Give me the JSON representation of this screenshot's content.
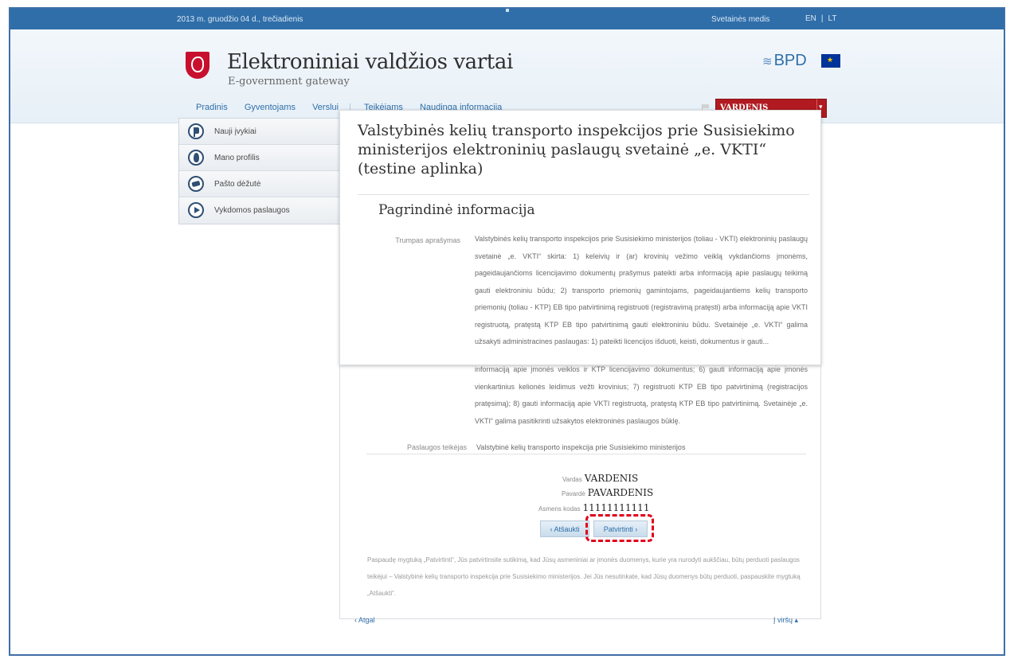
{
  "topbar": {
    "date": "2013 m. gruodžio 04 d., trečiadienis",
    "sitemap": "Svetainės medis",
    "lang_en": "EN",
    "lang_sep": "|",
    "lang_lt": "LT"
  },
  "header": {
    "title": "Elektroniniai valdžios vartai",
    "subtitle": "E-government gateway",
    "bpd": "BPD"
  },
  "nav": {
    "items": [
      "Pradinis",
      "Gyventojams",
      "Verslui",
      "Teikėjams",
      "Naudinga informacija"
    ],
    "user_name": "VARDENIS PAVARDENIS"
  },
  "sidebar": {
    "items": [
      "Nauji įvykiai",
      "Mano profilis",
      "Pašto dėžutė",
      "Vykdomos paslaugos"
    ]
  },
  "main": {
    "page_title": "Valstybinės kelių transporto inspekcijos prie Susisiekimo ministerijos elektroninių paslaugų svetainė „e. VKTI“ (testine aplinka)",
    "section_title": "Pagrindinė informacija",
    "short_desc_label": "Trumpas aprašymas",
    "short_desc_top": "Valstybinės kelių transporto inspekcijos prie Susisiekimo ministerijos (toliau - VKTI) elektroninių paslaugų svetainė „e. VKTI“ skirta: 1) keleivių ir (ar) krovinių vežimo veiklą vykdančioms įmonėms, pageidaujančioms licencijavimo dokumentų prašymus pateikti arba informaciją apie paslaugų teikimą gauti elektroniniu būdu; 2) transporto priemonių gamintojams, pageidaujantiems kelių transporto priemonių (toliau - KTP) EB tipo patvirtinimą registruoti (registravimą pratęsti) arba informaciją apie VKTI registruotą, pratęstą KTP EB tipo patvirtinimą gauti elektroniniu būdu. Svetainėje „e. VKTI“ galima užsakyti administracines paslaugas: 1) pateikti licencijos išduoti, keisti, dokumentus ir gauti...",
    "short_desc_bottom": "informaciją apie įmonės veiklos ir KTP licencijavimo dokumentus; 6) gauti informaciją apie įmonės vienkartinius kelionės leidimus vežti krovinius; 7) registruoti KTP EB tipo patvirtinimą (registracijos pratęsimą); 8) gauti informaciją apie VKTI registruotą, pratęstą KTP EB tipo patvirtinimą. Svetainėje „e. VKTI“ galima pasitikrinti užsakytos elektroninės paslaugos būklę.",
    "provider_label": "Paslaugos teikėjas",
    "provider_value": "Valstybinė kelių transporto inspekcija prie Susisiekimo ministerijos",
    "vardas_label": "Vardas",
    "vardas_value": "VARDENIS",
    "pavarde_label": "Pavardė",
    "pavarde_value": "PAVARDENIS",
    "asmens_label": "Asmens kodas",
    "asmens_value": "11111111111",
    "cancel_button": "‹  Atšaukti",
    "confirm_button": "Patvirtinti  ›",
    "notice": "Paspaudę mygtuką „Patvirtinti“, Jūs patvirtinsite sutikimą, kad Jūsų asmeniniai ar įmonės duomenys, kurie yra nurodyti aukščiau, būtų perduoti paslaugos teikėjui – Valstybinė kelių transporto inspekcija prie Susisiekimo ministerijos. Jei Jūs nesutinkate, kad Jūsų duomenys būtų perduoti, paspauskite mygtuką „Atšaukti“.",
    "back_link": "‹ Atgal",
    "top_link": "Į viršų ▴"
  },
  "colors": {
    "topbar": "#2f6ea9",
    "user_box": "#b01a20",
    "highlight": "#e0001b"
  },
  "icons": [
    "coat-of-arms-icon",
    "flag-icon",
    "user-icon",
    "mail-icon",
    "play-icon",
    "eu-flag-icon"
  ]
}
